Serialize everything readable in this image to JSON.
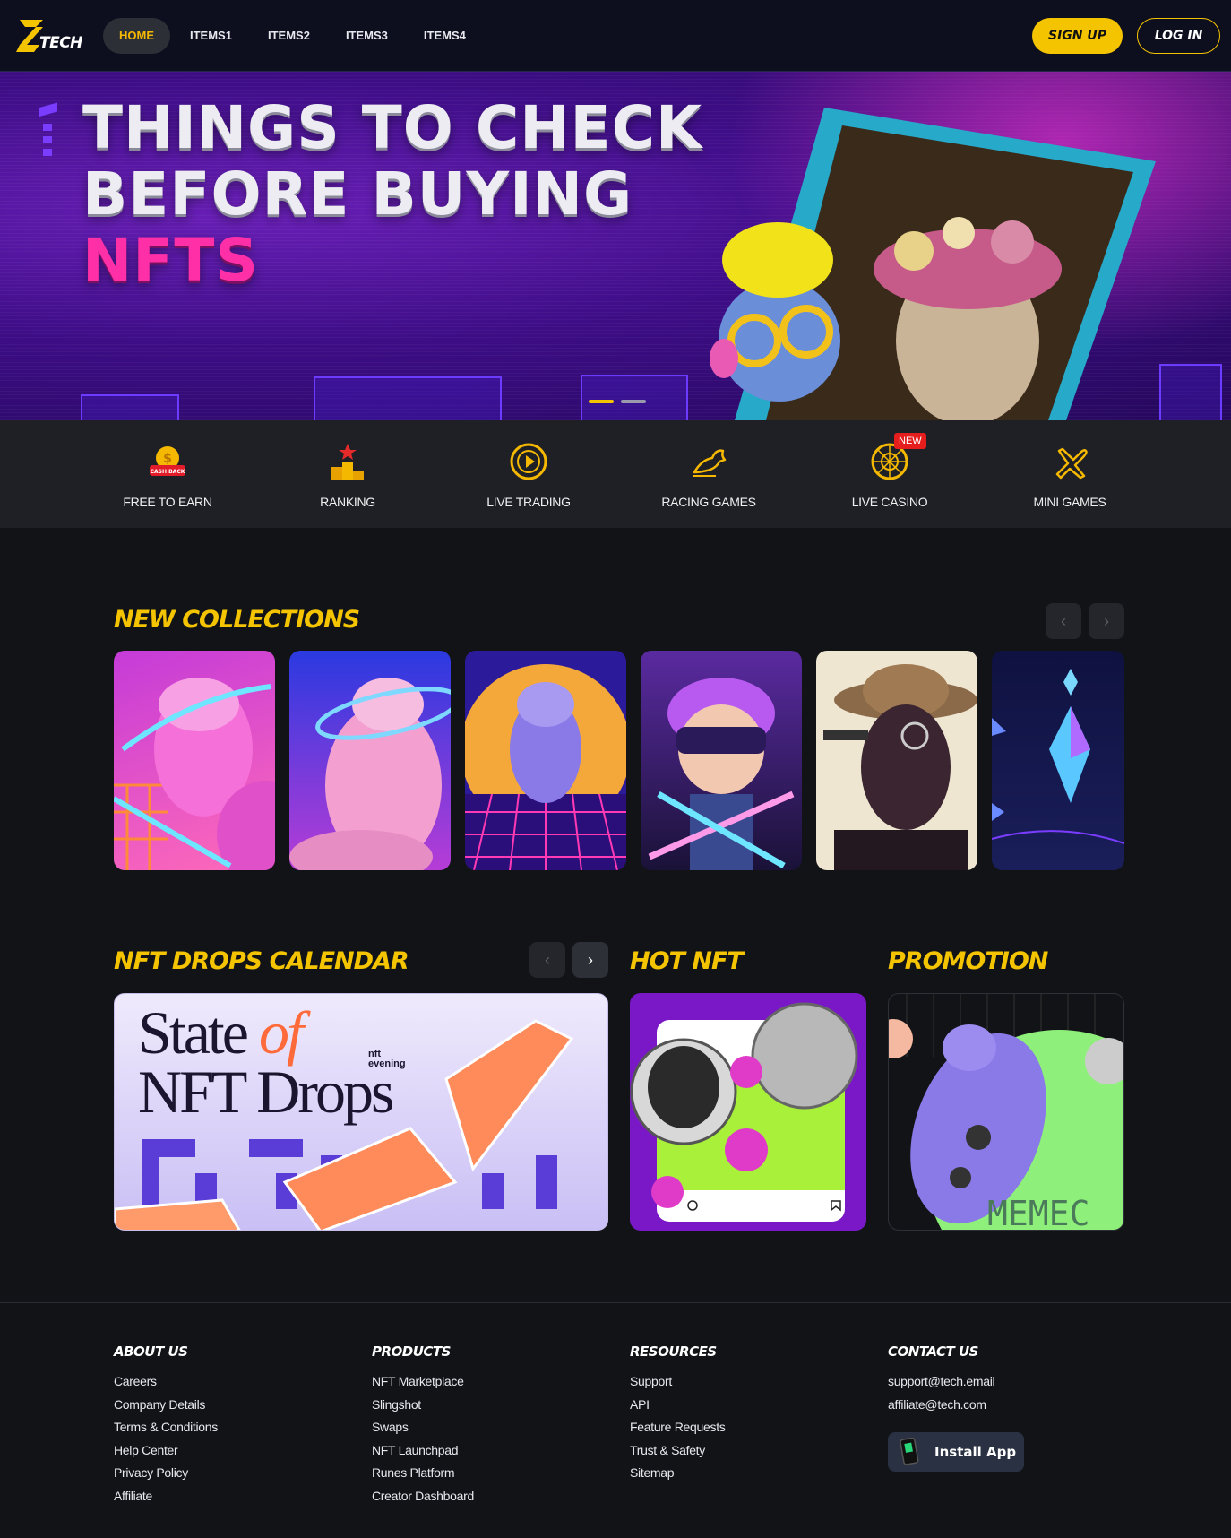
{
  "brand": {
    "logo_text": "TECH",
    "accent": "#f5c400",
    "highlight": "#ff2fa8"
  },
  "nav": {
    "items": [
      {
        "label": "HOME",
        "active": true
      },
      {
        "label": "ITEMS1"
      },
      {
        "label": "ITEMS2"
      },
      {
        "label": "ITEMS3"
      },
      {
        "label": "ITEMS4"
      }
    ],
    "signup": "SIGN UP",
    "login": "LOG IN"
  },
  "hero": {
    "line1": "THINGS TO CHECK",
    "line2": "BEFORE BUYING",
    "line3": "NFTS",
    "slide_count": 2,
    "active_slide": 1
  },
  "categories": [
    {
      "label": "FREE TO EARN",
      "icon": "cashback-coin-icon",
      "icon_text": "CASH BACK"
    },
    {
      "label": "RANKING",
      "icon": "podium-icon"
    },
    {
      "label": "LIVE TRADING",
      "icon": "play-circle-icon"
    },
    {
      "label": "RACING GAMES",
      "icon": "horse-racing-icon"
    },
    {
      "label": "LIVE CASINO",
      "icon": "roulette-icon",
      "badge": "NEW"
    },
    {
      "label": "MINI GAMES",
      "icon": "airplane-icon"
    }
  ],
  "sections": {
    "new_collections": "NEW COLLECTIONS",
    "drops_calendar": "NFT DROPS CALENDAR",
    "hot_nft": "HOT NFT",
    "promotion": "PROMOTION"
  },
  "drops_card": {
    "title1": "State",
    "title_of": "of",
    "title2": "NFT Drops",
    "brand1": "nft",
    "brand2": "evening"
  },
  "promo_card": {
    "text": "MEMEC"
  },
  "footer": {
    "columns": [
      {
        "title": "ABOUT US",
        "links": [
          "Careers",
          "Company Details",
          "Terms & Conditions",
          "Help Center",
          "Privacy Policy",
          "Affiliate"
        ]
      },
      {
        "title": "PRODUCTS",
        "links": [
          "NFT Marketplace",
          "Slingshot",
          "Swaps",
          "NFT Launchpad",
          "Runes Platform",
          "Creator Dashboard"
        ]
      },
      {
        "title": "RESOURCES",
        "links": [
          "Support",
          "API",
          "Feature Requests",
          "Trust & Safety",
          "Sitemap"
        ]
      },
      {
        "title": "CONTACT US",
        "links": [
          "support@tech.email",
          "affiliate@tech.com"
        ]
      }
    ],
    "install_app": "Install App"
  }
}
